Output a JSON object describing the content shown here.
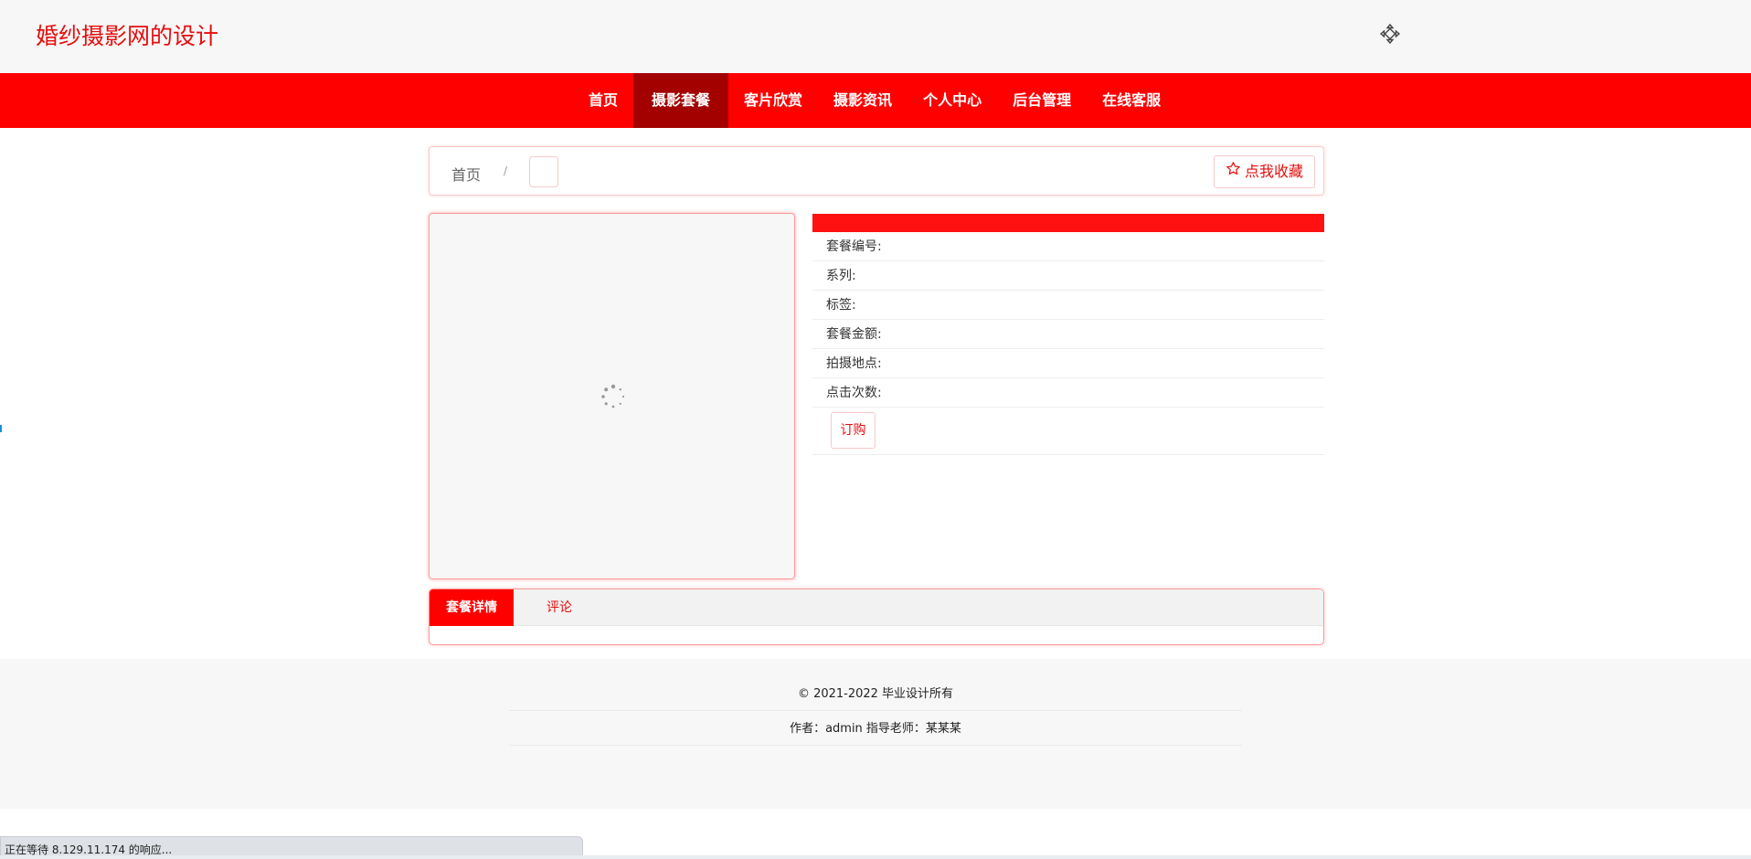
{
  "header": {
    "site_title": "婚纱摄影网的设计",
    "top_icon": "move-arrows-icon"
  },
  "nav": {
    "items": [
      {
        "label": "首页"
      },
      {
        "label": "摄影套餐",
        "active": true
      },
      {
        "label": "客片欣赏"
      },
      {
        "label": "摄影资讯"
      },
      {
        "label": "个人中心"
      },
      {
        "label": "后台管理"
      },
      {
        "label": "在线客服"
      }
    ]
  },
  "breadcrumb": {
    "home": "首页",
    "separator": "/",
    "current": ""
  },
  "favorite": {
    "label": "点我收藏",
    "icon": "star-outline-icon"
  },
  "product": {
    "image_state": "loading-spinner",
    "title": "",
    "fields": [
      {
        "label": "套餐编号:",
        "value": ""
      },
      {
        "label": "系列:",
        "value": ""
      },
      {
        "label": "标签:",
        "value": ""
      },
      {
        "label": "套餐金额:",
        "value": ""
      },
      {
        "label": "拍摄地点:",
        "value": ""
      },
      {
        "label": "点击次数:",
        "value": ""
      }
    ],
    "order_label": "订购"
  },
  "tabs": [
    {
      "label": "套餐详情",
      "active": true
    },
    {
      "label": "评论",
      "active": false
    }
  ],
  "footer": {
    "copyright": "© 2021-2022 毕业设计所有",
    "author": "作者：admin 指导老师：某某某"
  },
  "status_bar": {
    "text": "正在等待 8.129.11.174 的响应..."
  },
  "colors": {
    "primary": "#ff0000",
    "nav_active": "#a30000",
    "title_red": "#e60d0d"
  }
}
